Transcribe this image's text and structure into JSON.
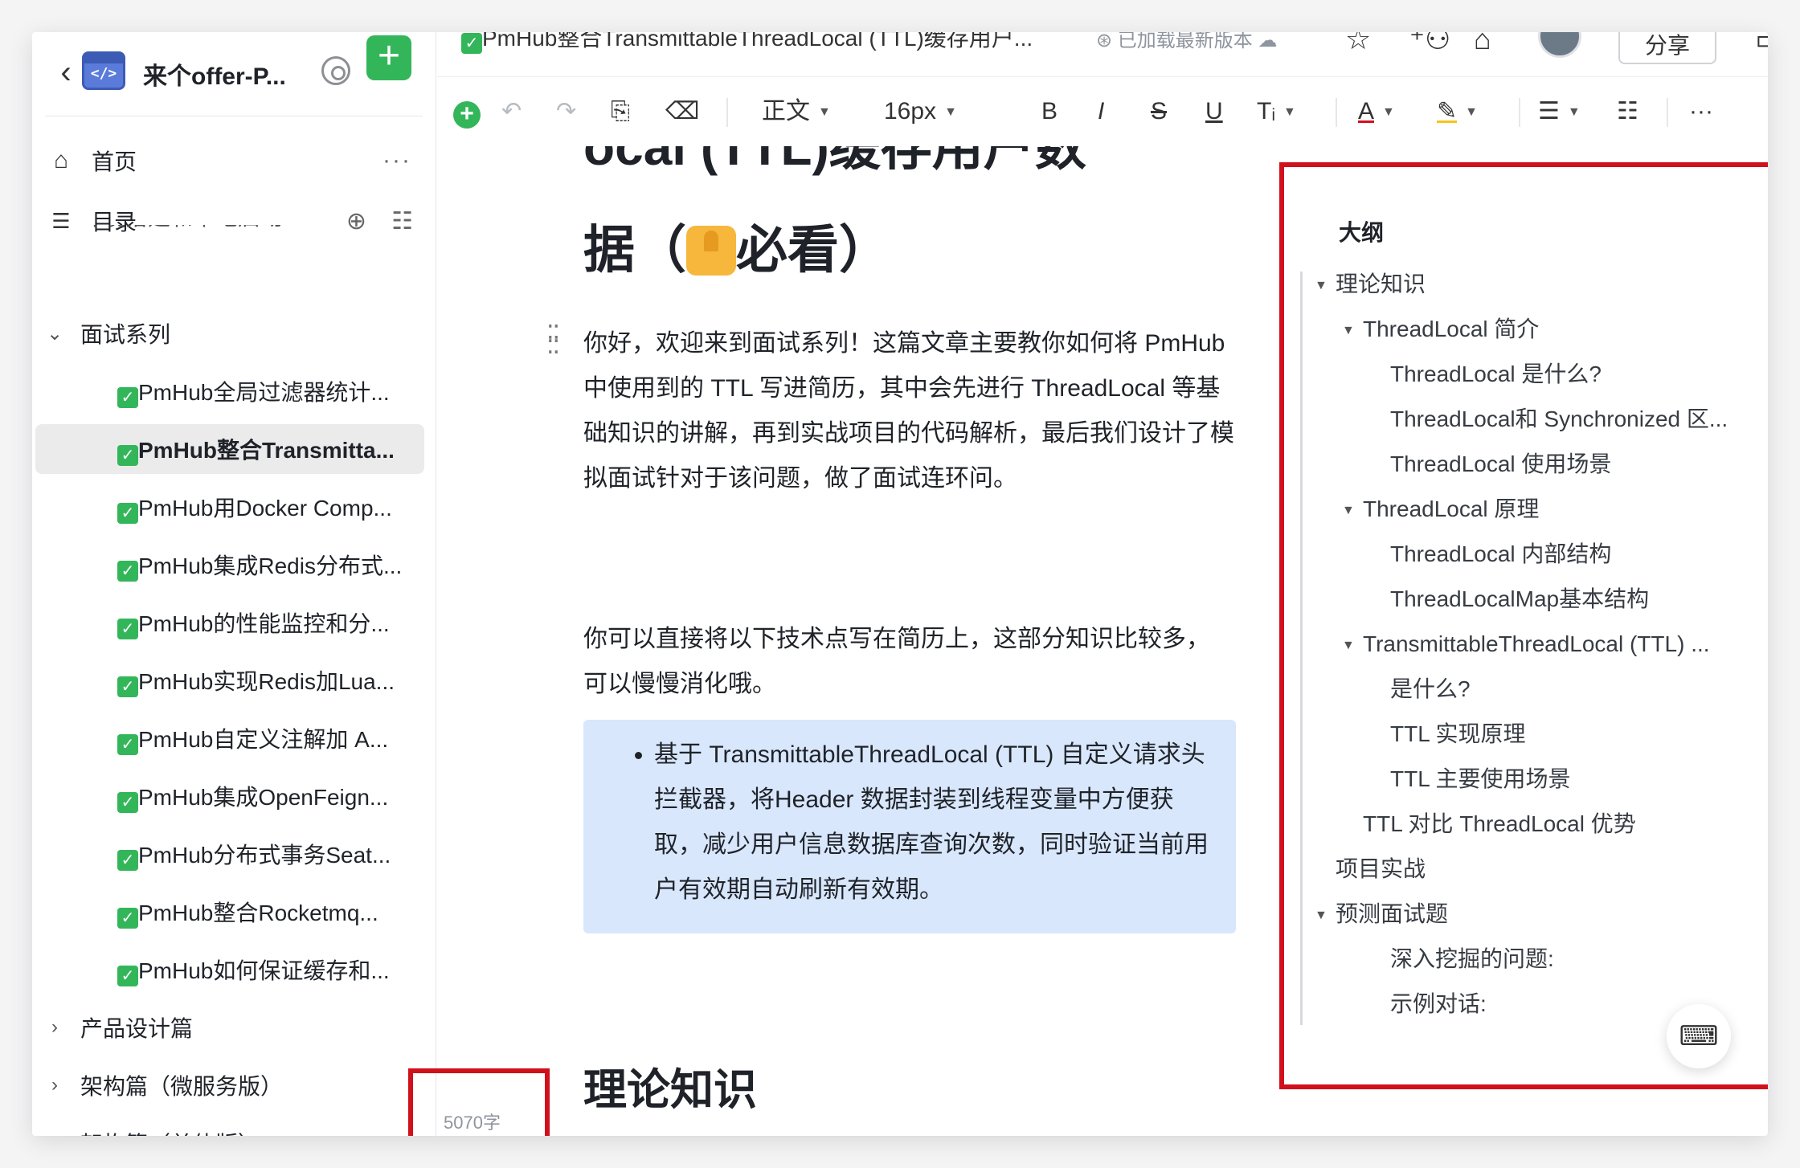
{
  "sidebar": {
    "back_icon": "chevron-left-icon",
    "logo_glyph": "</>",
    "title": "来个offer-P...",
    "home_label": "首页",
    "toc_label": "目录",
    "more_glyph": "···",
    "cut_item": "环境搭建和本地启动",
    "tree": [
      {
        "label": "面试系列",
        "expanded": true,
        "level": 0
      },
      {
        "label": "PmHub全局过滤器统计...",
        "level": 1,
        "checked": true
      },
      {
        "label": "PmHub整合Transmitta...",
        "level": 1,
        "checked": true,
        "active": true
      },
      {
        "label": "PmHub用Docker Comp...",
        "level": 1,
        "checked": true
      },
      {
        "label": "PmHub集成Redis分布式...",
        "level": 1,
        "checked": true
      },
      {
        "label": "PmHub的性能监控和分...",
        "level": 1,
        "checked": true
      },
      {
        "label": "PmHub实现Redis加Lua...",
        "level": 1,
        "checked": true
      },
      {
        "label": "PmHub自定义注解加 A...",
        "level": 1,
        "checked": true
      },
      {
        "label": "PmHub集成OpenFeign...",
        "level": 1,
        "checked": true
      },
      {
        "label": "PmHub分布式事务Seat...",
        "level": 1,
        "checked": true
      },
      {
        "label": "PmHub整合Rocketmq...",
        "level": 1,
        "checked": true
      },
      {
        "label": "PmHub如何保证缓存和...",
        "level": 1,
        "checked": true
      },
      {
        "label": "产品设计篇",
        "expanded": false,
        "level": 0
      },
      {
        "label": "架构篇（微服务版）",
        "expanded": false,
        "level": 0
      },
      {
        "label": "架构篇（单体版）",
        "expanded": false,
        "level": 0
      }
    ],
    "word_count": "5070字"
  },
  "topbar": {
    "doc_title": "PmHub整合TransmittableThreadLocal (TTL)缓存用户...",
    "status": "已加载最新版本",
    "share_label": "分享"
  },
  "toolbar": {
    "style_label": "正文",
    "size_label": "16px",
    "bold": "B",
    "italic": "I",
    "strike": "S",
    "underline": "U",
    "more": "···"
  },
  "doc": {
    "title_cut": "ocal (TTL)缓存用户数",
    "title_line2_a": "据（",
    "title_line2_b": "必看）",
    "para1": "你好，欢迎来到面试系列！这篇文章主要教你如何将 PmHub 中使用到的 TTL 写进简历，其中会先进行 ThreadLocal 等基础知识的讲解，再到实战项目的代码解析，最后我们设计了模拟面试针对于该问题，做了面试连环问。",
    "para2": "你可以直接将以下技术点写在简历上，这部分知识比较多，可以慢慢消化哦。",
    "callout_item": "基于 TransmittableThreadLocal (TTL) 自定义请求头拦截器，将Header 数据封装到线程变量中方便获取，减少用户信息数据库查询次数，同时验证当前用户有效期自动刷新有效期。",
    "h2": "理论知识"
  },
  "outline": {
    "title": "大纲",
    "items": [
      {
        "label": "理论知识",
        "level": 0,
        "expanded": true
      },
      {
        "label": "ThreadLocal 简介",
        "level": 1,
        "expanded": true
      },
      {
        "label": "ThreadLocal 是什么?",
        "level": 2
      },
      {
        "label": "ThreadLocal和 Synchronized 区...",
        "level": 2
      },
      {
        "label": "ThreadLocal 使用场景",
        "level": 2
      },
      {
        "label": "ThreadLocal 原理",
        "level": 1,
        "expanded": true
      },
      {
        "label": "ThreadLocal 内部结构",
        "level": 2
      },
      {
        "label": "ThreadLocalMap基本结构",
        "level": 2
      },
      {
        "label": "TransmittableThreadLocal (TTL) ...",
        "level": 1,
        "expanded": true
      },
      {
        "label": "是什么?",
        "level": 2
      },
      {
        "label": "TTL 实现原理",
        "level": 2
      },
      {
        "label": "TTL 主要使用场景",
        "level": 2
      },
      {
        "label": "TTL 对比 ThreadLocal 优势",
        "level": 1
      },
      {
        "label": "项目实战",
        "level": 0
      },
      {
        "label": "预测面试题",
        "level": 0,
        "expanded": true
      },
      {
        "label": "深入挖掘的问题:",
        "level": 2
      },
      {
        "label": "示例对话:",
        "level": 2
      }
    ]
  },
  "colors": {
    "accent_green": "#33b65a",
    "highlight_red": "#d0111b",
    "callout_bg": "#d9e7fd"
  }
}
